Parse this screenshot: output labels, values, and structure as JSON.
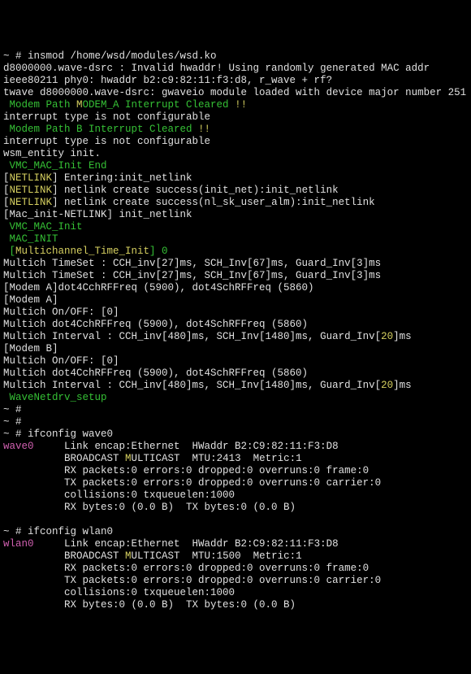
{
  "prompt": "~ # ",
  "l": {
    "00": "~ # insmod /home/wsd/modules/wsd.ko",
    "01": "d8000000.wave-dsrc : Invalid hwaddr! Using randomly generated MAC addr",
    "02": "ieee80211 phy0: hwaddr b2:c9:82:11:f3:d8, r_wave + rf?",
    "03": "twave d8000000.wave-dsrc: gwaveio module loaded with device major number 251",
    "04a": " Modem Path ",
    "04b": "M",
    "04c": "ODEM_A Interrupt Cleared ",
    "04d": "!!",
    "05": "interrupt type is not configurable",
    "06a": " Modem Path B Interrupt Cleared ",
    "06b": "!!",
    "07": "interrupt type is not configurable",
    "08": "wsm_entity init.",
    "09a": " VMC_MAC_Init End",
    "10a": "[",
    "10b": "NETLINK",
    "10c": "] Entering:init_netlink",
    "11a": "[",
    "11b": "NETLINK",
    "11c": "] netlink create success(init_net):init_netlink",
    "12a": "[",
    "12b": "NETLINK",
    "12c": "] netlink create success(nl_sk_user_alm):init_netlink",
    "13": "[Mac_init-NETLINK] init_netlink",
    "14": " VMC_MAC_Init",
    "15": " MAC_INIT",
    "16a": " [",
    "16b": "Multichannel_Time_Init",
    "16c": "] 0",
    "17": "Multich TimeSet : CCH_inv[27]ms, SCH_Inv[67]ms, Guard_Inv[3]ms",
    "18": "Multich TimeSet : CCH_inv[27]ms, SCH_Inv[67]ms, Guard_Inv[3]ms",
    "19": "[Modem A]dot4CchRFFreq (5900), dot4SchRFFreq (5860)",
    "20": "[Modem A]",
    "21": "Multich On/OFF: [0]",
    "22": "Multich dot4CchRFFreq (5900), dot4SchRFFreq (5860)",
    "23a": "Multich Interval : CCH_inv[480]ms, SCH_Inv[1480]ms, Guard_Inv[",
    "23b": "20",
    "23c": "]ms",
    "24": "[Modem B]",
    "25": "Multich On/OFF: [0]",
    "26": "Multich dot4CchRFFreq (5900), dot4SchRFFreq (5860)",
    "27a": "Multich Interval : CCH_inv[480]ms, SCH_Inv[1480]ms, Guard_Inv[",
    "27b": "20",
    "27c": "]ms",
    "28": " WaveNetdrv_setup",
    "29": "~ #",
    "30": "~ #",
    "31": "~ # ifconfig wave0",
    "if1_name": "wave0",
    "if1_a": "     Link encap:Ethernet  HWaddr B2:C9:82:11:F3:D8",
    "if1_b": "          BROADCAST ",
    "if1_b2": "M",
    "if1_b3": "ULTICAST  MTU:2413  Metric:1",
    "if1_c": "          RX packets:0 errors:0 dropped:0 overruns:0 frame:0",
    "if1_d": "          TX packets:0 errors:0 dropped:0 overruns:0 carrier:0",
    "if1_e": "          collisions:0 txqueuelen:1000",
    "if1_f": "          RX bytes:0 (0.0 B)  TX bytes:0 (0.0 B)",
    "blank": "",
    "32": "~ # ifconfig wlan0",
    "if2_name": "wlan0",
    "if2_a": "     Link encap:Ethernet  HWaddr B2:C9:82:11:F3:D8",
    "if2_b": "          BROADCAST ",
    "if2_b2": "M",
    "if2_b3": "ULTICAST  MTU:1500  Metric:1",
    "if2_c": "          RX packets:0 errors:0 dropped:0 overruns:0 frame:0",
    "if2_d": "          TX packets:0 errors:0 dropped:0 overruns:0 carrier:0",
    "if2_e": "          collisions:0 txqueuelen:1000",
    "if2_f": "          RX bytes:0 (0.0 B)  TX bytes:0 (0.0 B)"
  }
}
